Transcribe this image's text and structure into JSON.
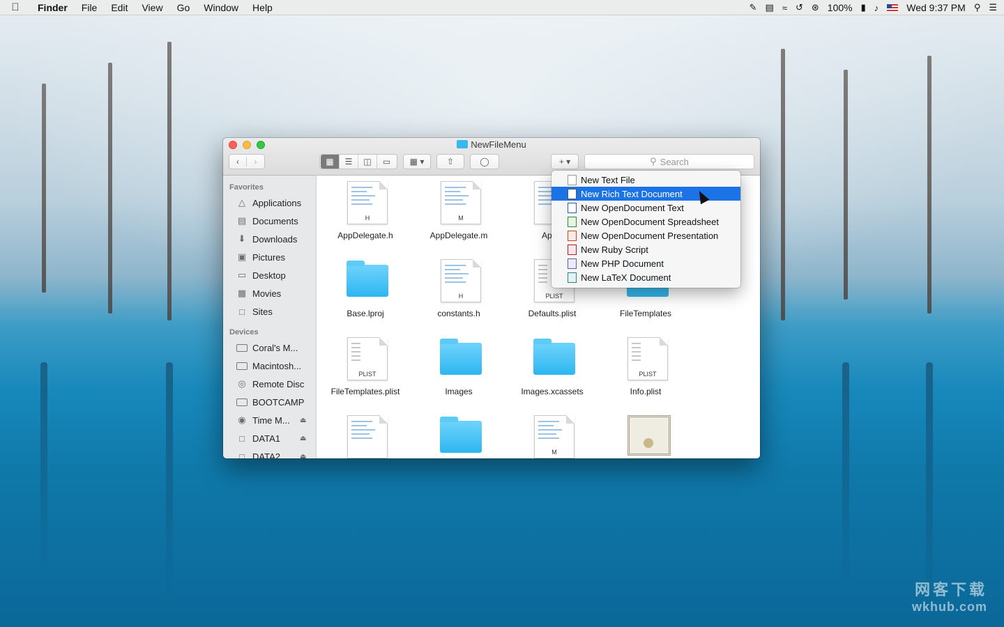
{
  "menubar": {
    "apple_icon": "apple-icon",
    "app_name": "Finder",
    "items": [
      "File",
      "Edit",
      "View",
      "Go",
      "Window",
      "Help"
    ],
    "battery": "100%",
    "clock": "Wed 9:37 PM"
  },
  "window": {
    "title": "NewFileMenu",
    "search_placeholder": "Search"
  },
  "sidebar": {
    "favorites_title": "Favorites",
    "favorites": [
      {
        "label": "Applications",
        "icon": "applications-icon"
      },
      {
        "label": "Documents",
        "icon": "documents-icon"
      },
      {
        "label": "Downloads",
        "icon": "downloads-icon"
      },
      {
        "label": "Pictures",
        "icon": "pictures-icon"
      },
      {
        "label": "Desktop",
        "icon": "desktop-icon"
      },
      {
        "label": "Movies",
        "icon": "movies-icon"
      },
      {
        "label": "Sites",
        "icon": "folder-icon"
      }
    ],
    "devices_title": "Devices",
    "devices": [
      {
        "label": "Coral's M..."
      },
      {
        "label": "Macintosh..."
      },
      {
        "label": "Remote Disc"
      },
      {
        "label": "BOOTCAMP"
      },
      {
        "label": "Time M..."
      },
      {
        "label": "DATA1"
      },
      {
        "label": "DATA2"
      }
    ]
  },
  "files": [
    {
      "name": "AppDelegate.h",
      "kind": "source",
      "tag": "H"
    },
    {
      "name": "AppDelegate.m",
      "kind": "source",
      "tag": "M"
    },
    {
      "name": "AppU",
      "kind": "source",
      "tag": "H"
    },
    {
      "name": "",
      "kind": "none",
      "tag": ""
    },
    {
      "name": "Base.lproj",
      "kind": "folder",
      "tag": ""
    },
    {
      "name": "constants.h",
      "kind": "source",
      "tag": "H"
    },
    {
      "name": "Defaults.plist",
      "kind": "plist",
      "tag": "PLIST"
    },
    {
      "name": "FileTemplates",
      "kind": "folder",
      "tag": ""
    },
    {
      "name": "FileTemplates.plist",
      "kind": "plist",
      "tag": "PLIST"
    },
    {
      "name": "Images",
      "kind": "folder",
      "tag": ""
    },
    {
      "name": "Images.xcassets",
      "kind": "folder",
      "tag": ""
    },
    {
      "name": "Info.plist",
      "kind": "plist",
      "tag": "PLIST"
    },
    {
      "name": "",
      "kind": "source",
      "tag": ""
    },
    {
      "name": "",
      "kind": "folder",
      "tag": ""
    },
    {
      "name": "",
      "kind": "source",
      "tag": "M"
    },
    {
      "name": "",
      "kind": "certificate",
      "tag": ""
    }
  ],
  "new_menu": {
    "items": [
      {
        "label": "New Text File",
        "icon": "text-file-icon",
        "selected": false
      },
      {
        "label": "New Rich Text Document",
        "icon": "rich-text-icon",
        "selected": true
      },
      {
        "label": "New OpenDocument Text",
        "icon": "odt-icon",
        "selected": false
      },
      {
        "label": "New OpenDocument Spreadsheet",
        "icon": "ods-icon",
        "selected": false
      },
      {
        "label": "New OpenDocument Presentation",
        "icon": "odp-icon",
        "selected": false
      },
      {
        "label": "New Ruby Script",
        "icon": "ruby-icon",
        "selected": false
      },
      {
        "label": "New PHP Document",
        "icon": "php-icon",
        "selected": false
      },
      {
        "label": "New LaTeX Document",
        "icon": "latex-icon",
        "selected": false
      }
    ]
  },
  "watermark": {
    "line1": "网客下载",
    "line2": "wkhub.com"
  },
  "colors": {
    "selection": "#1c73e6",
    "folder": "#2db6f0",
    "close": "#fc605c",
    "minimize": "#fdbc40",
    "maximize": "#34c84a"
  }
}
